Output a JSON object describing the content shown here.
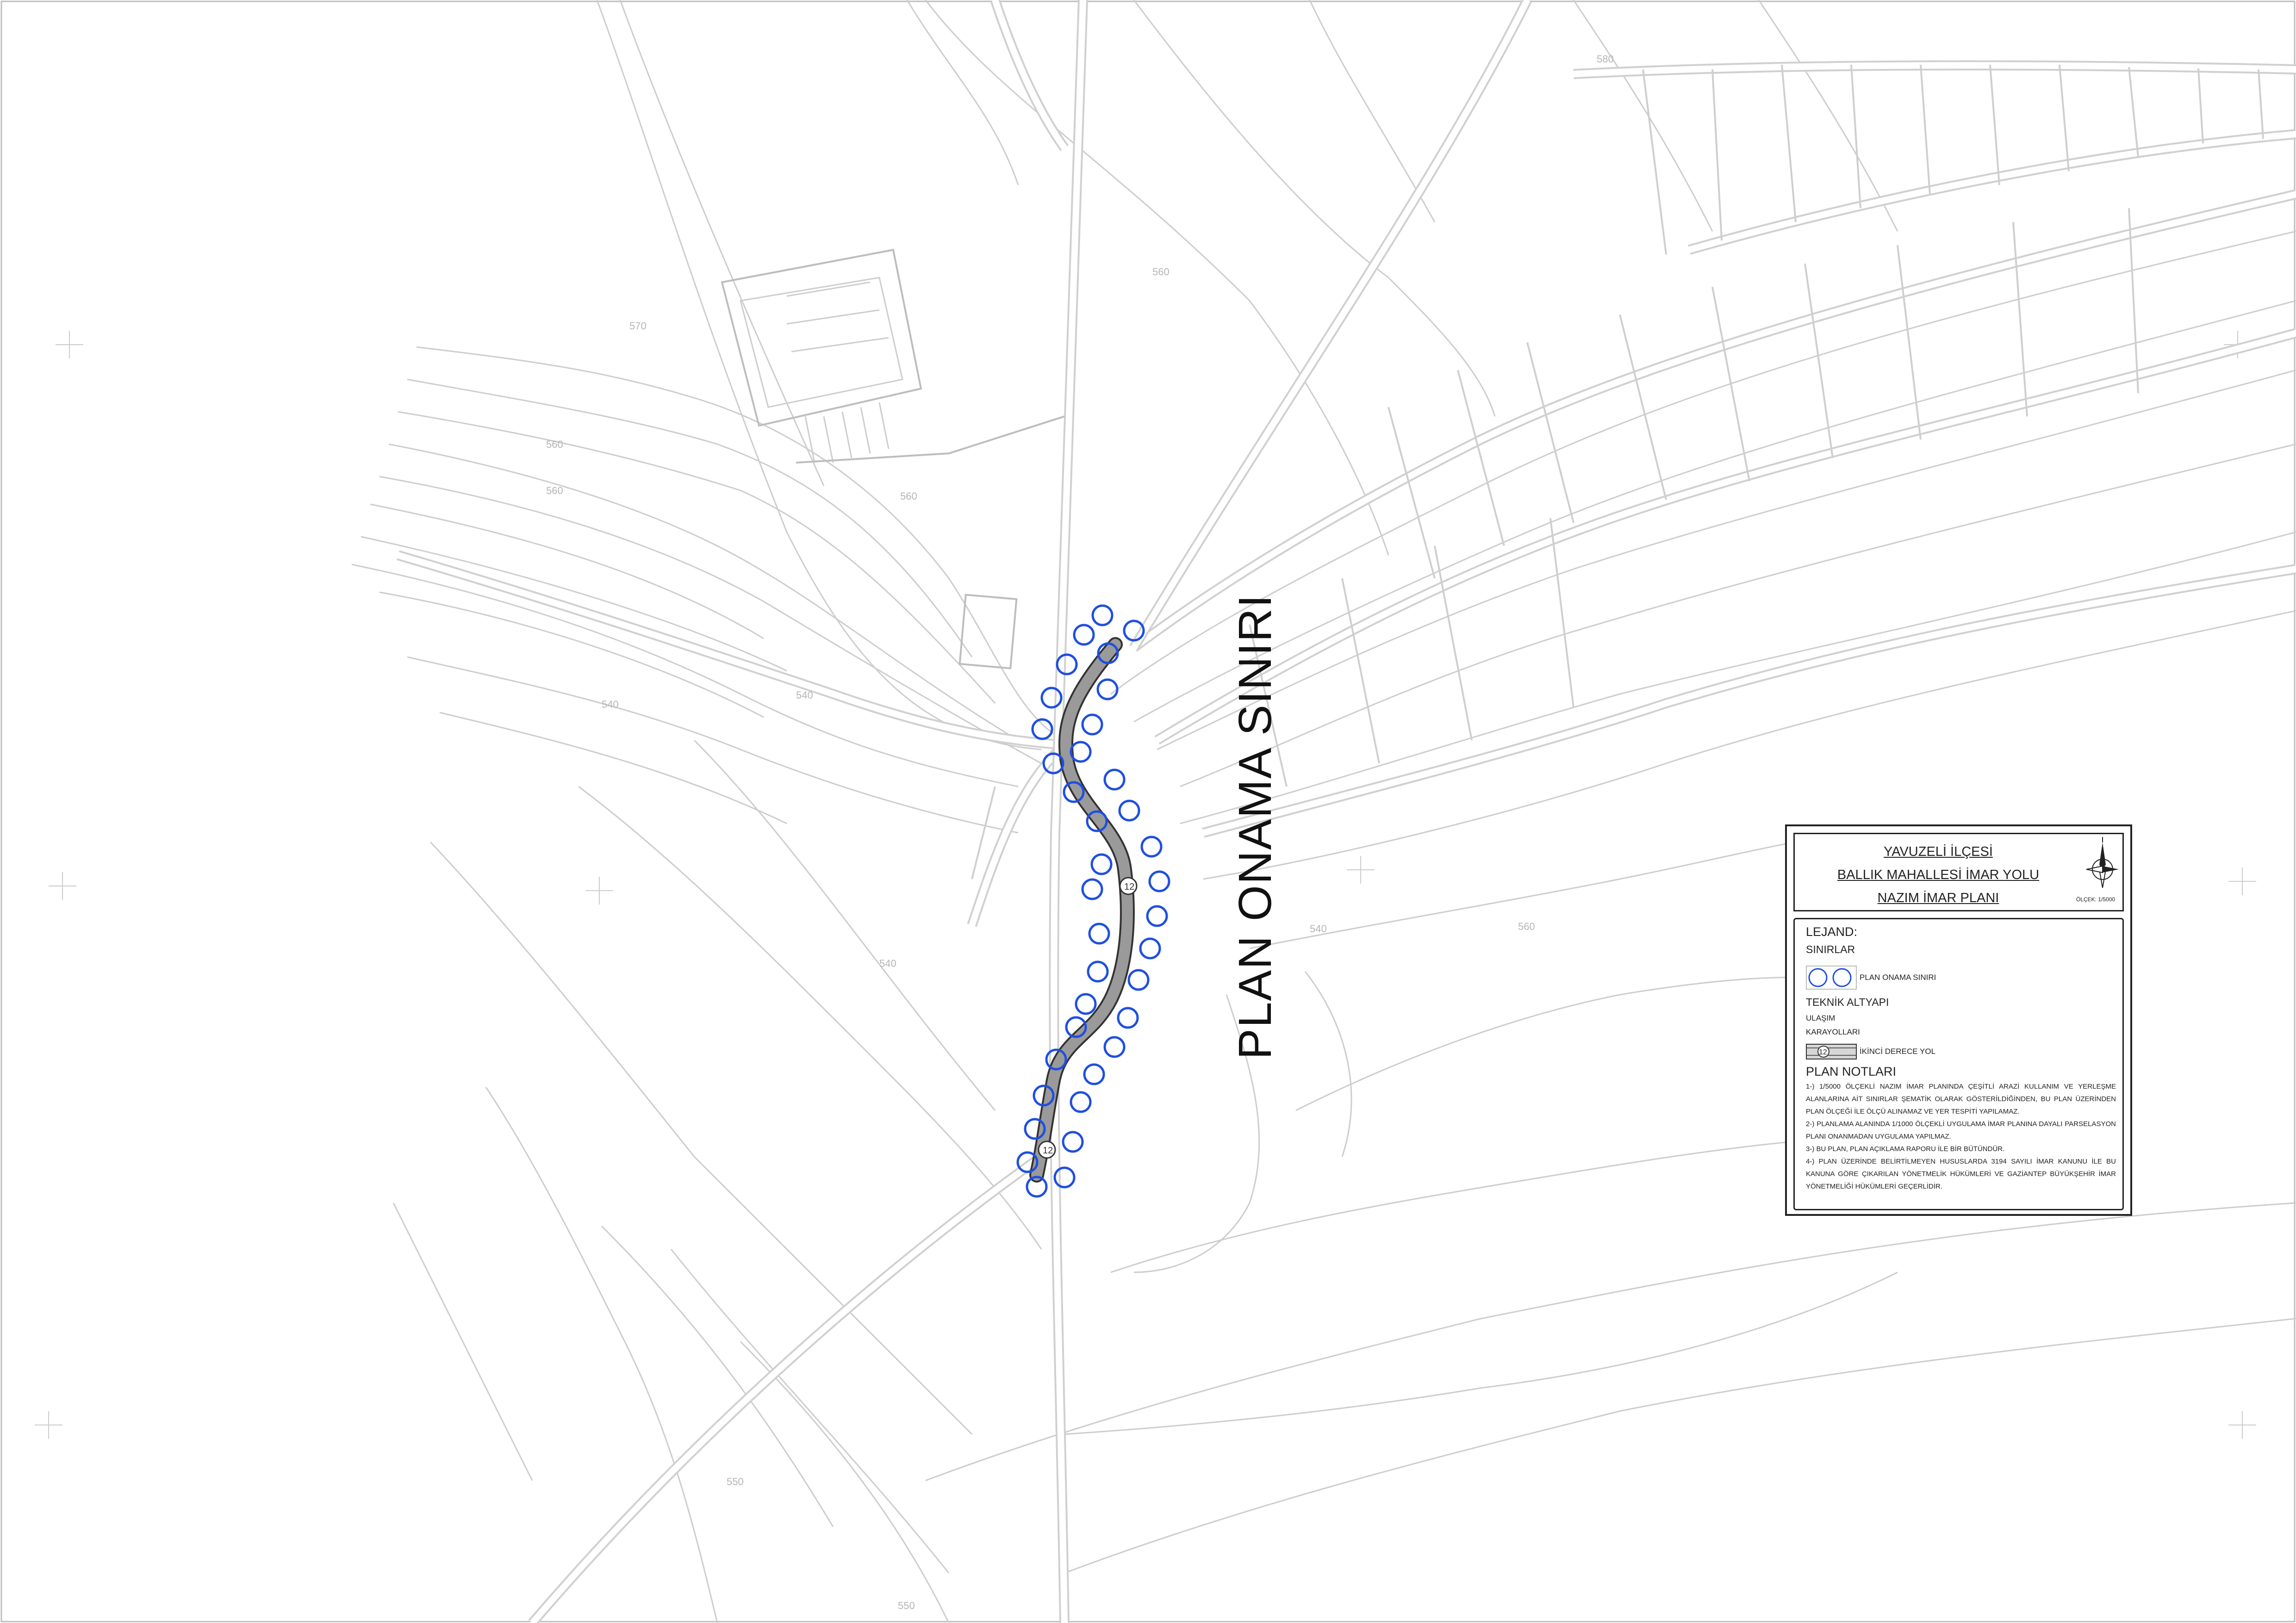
{
  "map": {
    "boundary_label": "PLAN ONAMA SINIRI",
    "elevation_labels": [
      "570",
      "560",
      "560",
      "540",
      "540",
      "540",
      "560",
      "540",
      "560",
      "550",
      "550",
      "580",
      "560"
    ],
    "road_markers": [
      "12",
      "12"
    ],
    "colors": {
      "boundary": "#1f4fe0",
      "road": "#9a9a9a",
      "contours": "#cdcdcd"
    }
  },
  "legend": {
    "title_lines": [
      "YAVUZELİ İLÇESİ",
      "BALLIK MAHALLESİ İMAR YOLU",
      "NAZIM İMAR PLANI"
    ],
    "scale": "ÖLÇEK: 1/5000",
    "north_icon": "north-arrow-icon",
    "heading": "LEJAND:",
    "section_boundaries": "SINIRLAR",
    "boundary_item": "PLAN ONAMA SINIRI",
    "section_infra": "TEKNİK ALTYAPI",
    "section_transport": "ULAŞIM",
    "section_highways": "KARAYOLLARI",
    "road_symbol_label": "12",
    "road_item": "İKİNCİ DERECE YOL",
    "notes_heading": "PLAN NOTLARI",
    "notes": [
      "1-) 1/5000 ÖLÇEKLİ NAZIM İMAR PLANINDA ÇEŞİTLİ ARAZİ KULLANIM VE YERLEŞME ALANLARINA AİT SINIRLAR ŞEMATİK OLARAK GÖSTERİLDİĞİNDEN, BU PLAN ÜZERİNDEN PLAN ÖLÇEĞİ İLE ÖLÇÜ ALINAMAZ VE YER TESPİTİ YAPILAMAZ.",
      "2-) PLANLAMA ALANINDA 1/1000 ÖLÇEKLİ UYGULAMA İMAR PLANINA DAYALI PARSELASYON PLANI ONANMADAN UYGULAMA YAPILMAZ.",
      "3-) BU PLAN, PLAN AÇIKLAMA RAPORU İLE BİR BÜTÜNDÜR.",
      "4-) PLAN ÜZERİNDE BELİRTİLMEYEN HUSUSLARDA 3194 SAYILI İMAR KANUNU İLE BU KANUNA GÖRE ÇIKARILAN YÖNETMELİK HÜKÜMLERİ VE GAZİANTEP BÜYÜKŞEHİR İMAR YÖNETMELİĞİ HÜKÜMLERİ GEÇERLİDİR."
    ]
  }
}
